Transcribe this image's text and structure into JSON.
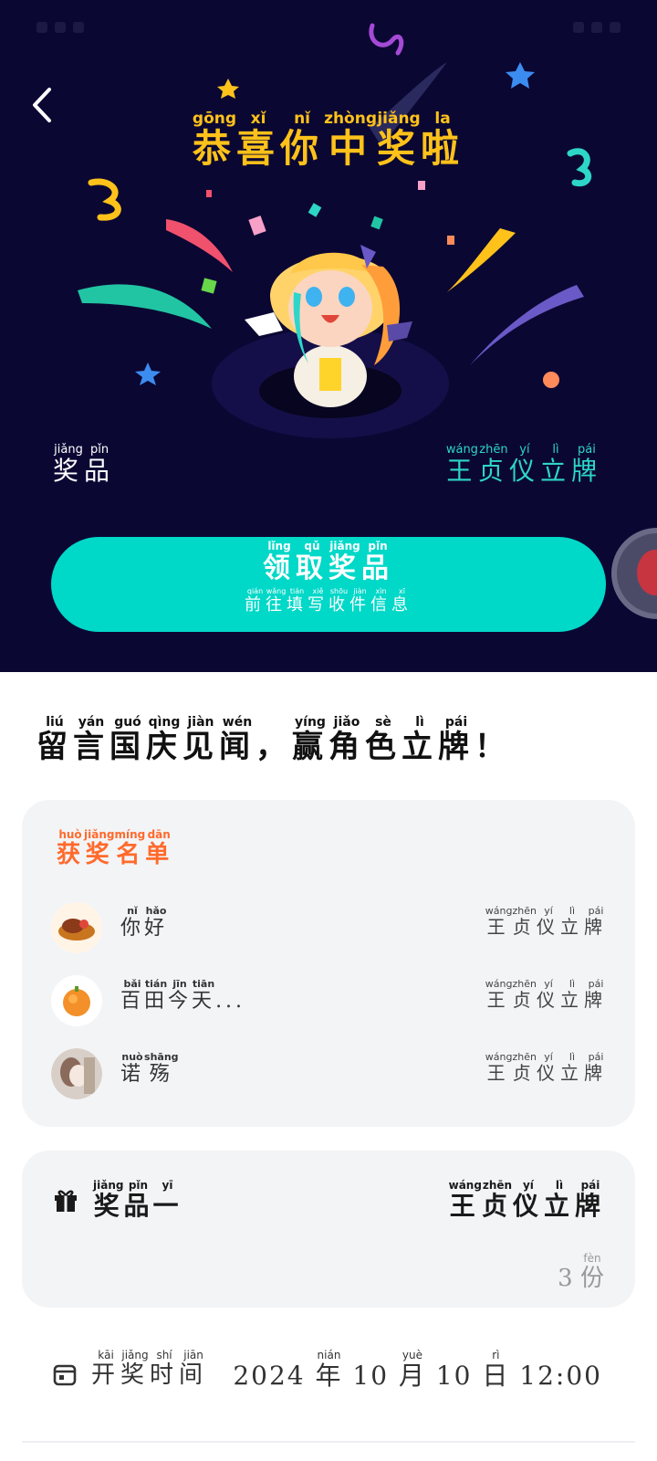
{
  "hero": {
    "congrats": [
      {
        "char": "恭",
        "py": "gōng"
      },
      {
        "char": "喜",
        "py": "xǐ"
      },
      {
        "char": "你",
        "py": "nǐ"
      },
      {
        "char": "中",
        "py": "zhòng"
      },
      {
        "char": "奖",
        "py": "jiǎng"
      },
      {
        "char": "啦",
        "py": "la"
      }
    ],
    "prize_label": [
      {
        "char": "奖",
        "py": "jiǎng"
      },
      {
        "char": "品",
        "py": "pǐn"
      }
    ],
    "prize_value": [
      {
        "char": "王",
        "py": "wáng"
      },
      {
        "char": "贞",
        "py": "zhēn"
      },
      {
        "char": "仪",
        "py": "yí"
      },
      {
        "char": "立",
        "py": "lì"
      },
      {
        "char": "牌",
        "py": "pái"
      }
    ],
    "claim_main": [
      {
        "char": "领",
        "py": "lǐng"
      },
      {
        "char": "取",
        "py": "qǔ"
      },
      {
        "char": "奖",
        "py": "jiǎng"
      },
      {
        "char": "品",
        "py": "pǐn"
      }
    ],
    "claim_sub": [
      {
        "char": "前",
        "py": "qián"
      },
      {
        "char": "往",
        "py": "wǎng"
      },
      {
        "char": "填",
        "py": "tián"
      },
      {
        "char": "写",
        "py": "xiě"
      },
      {
        "char": "收",
        "py": "shōu"
      },
      {
        "char": "件",
        "py": "jiàn"
      },
      {
        "char": "信",
        "py": "xìn"
      },
      {
        "char": "息",
        "py": "xī"
      }
    ]
  },
  "headline": [
    {
      "char": "留",
      "py": "liú"
    },
    {
      "char": "言",
      "py": "yán"
    },
    {
      "char": "国",
      "py": "guó"
    },
    {
      "char": "庆",
      "py": "qìng"
    },
    {
      "char": "见",
      "py": "jiàn"
    },
    {
      "char": "闻",
      "py": "wén"
    },
    {
      "char": "，",
      "py": ""
    },
    {
      "char": "赢",
      "py": "yíng"
    },
    {
      "char": "角",
      "py": "jiǎo"
    },
    {
      "char": "色",
      "py": "sè"
    },
    {
      "char": "立",
      "py": "lì"
    },
    {
      "char": "牌",
      "py": "pái"
    },
    {
      "char": "！",
      "py": ""
    }
  ],
  "winners": {
    "title": [
      {
        "char": "获",
        "py": "huò"
      },
      {
        "char": "奖",
        "py": "jiǎng"
      },
      {
        "char": "名",
        "py": "míng"
      },
      {
        "char": "单",
        "py": "dān"
      }
    ],
    "rows": [
      {
        "name": [
          {
            "char": "你",
            "py": "nǐ"
          },
          {
            "char": "好",
            "py": "hǎo"
          }
        ],
        "prize": [
          {
            "char": "王",
            "py": "wáng"
          },
          {
            "char": "贞",
            "py": "zhēn"
          },
          {
            "char": "仪",
            "py": "yí"
          },
          {
            "char": "立",
            "py": "lì"
          },
          {
            "char": "牌",
            "py": "pái"
          }
        ]
      },
      {
        "name": [
          {
            "char": "百",
            "py": "bǎi"
          },
          {
            "char": "田",
            "py": "tián"
          },
          {
            "char": "今",
            "py": "jīn"
          },
          {
            "char": "天",
            "py": "tiān"
          },
          {
            "char": "...",
            "py": ""
          }
        ],
        "prize": [
          {
            "char": "王",
            "py": "wáng"
          },
          {
            "char": "贞",
            "py": "zhēn"
          },
          {
            "char": "仪",
            "py": "yí"
          },
          {
            "char": "立",
            "py": "lì"
          },
          {
            "char": "牌",
            "py": "pái"
          }
        ]
      },
      {
        "name": [
          {
            "char": "诺",
            "py": "nuò"
          },
          {
            "char": "殇",
            "py": "shāng"
          }
        ],
        "prize": [
          {
            "char": "王",
            "py": "wáng"
          },
          {
            "char": "贞",
            "py": "zhēn"
          },
          {
            "char": "仪",
            "py": "yí"
          },
          {
            "char": "立",
            "py": "lì"
          },
          {
            "char": "牌",
            "py": "pái"
          }
        ]
      }
    ]
  },
  "prize_card": {
    "name": [
      {
        "char": "奖",
        "py": "jiǎng"
      },
      {
        "char": "品",
        "py": "pǐn"
      },
      {
        "char": "一",
        "py": "yī"
      }
    ],
    "item": [
      {
        "char": "王",
        "py": "wáng"
      },
      {
        "char": "贞",
        "py": "zhēn"
      },
      {
        "char": "仪",
        "py": "yí"
      },
      {
        "char": "立",
        "py": "lì"
      },
      {
        "char": "牌",
        "py": "pái"
      }
    ],
    "count": [
      {
        "char": "3 ",
        "py": ""
      },
      {
        "char": "份",
        "py": "fèn"
      }
    ]
  },
  "draw_time": {
    "label": [
      {
        "char": "开",
        "py": "kāi"
      },
      {
        "char": "奖",
        "py": "jiǎng"
      },
      {
        "char": "时",
        "py": "shí"
      },
      {
        "char": "间",
        "py": "jiān"
      }
    ],
    "value": [
      {
        "char": "2024 ",
        "py": ""
      },
      {
        "char": "年",
        "py": "nián"
      },
      {
        "char": " 10 ",
        "py": ""
      },
      {
        "char": "月",
        "py": "yuè"
      },
      {
        "char": " 10 ",
        "py": ""
      },
      {
        "char": "日",
        "py": "rì"
      },
      {
        "char": " 12:00",
        "py": ""
      }
    ]
  },
  "icons": {
    "back": "chevron-left-icon",
    "gift": "gift-icon",
    "calendar": "calendar-icon"
  },
  "colors": {
    "hero_bg": "#0b0733",
    "accent_teal": "#00d8c8",
    "congrats_gold": "#ffc21a",
    "winners_orange": "#ff6a2c"
  }
}
